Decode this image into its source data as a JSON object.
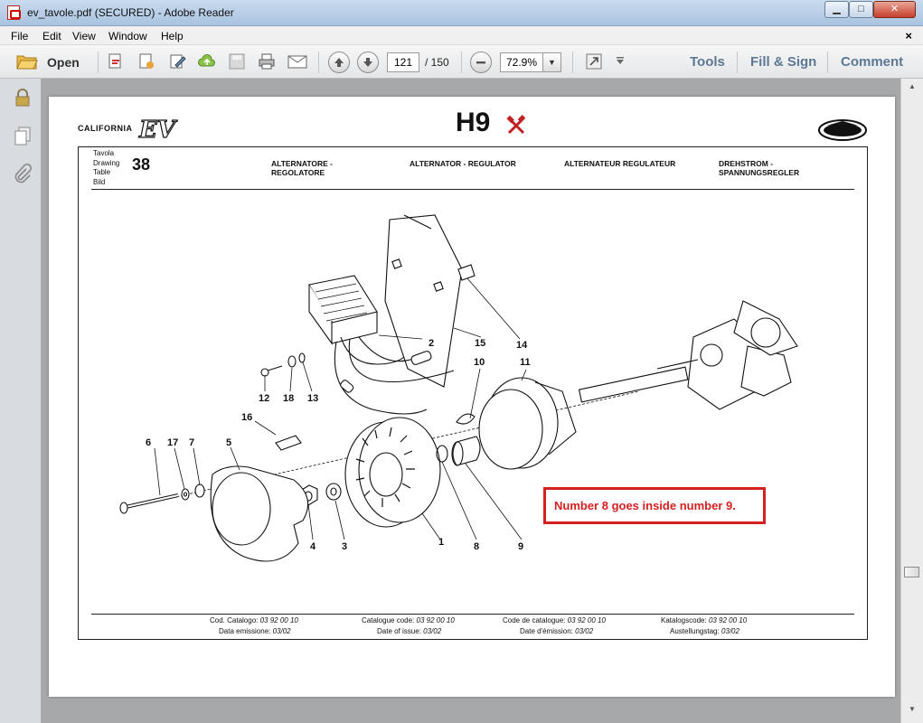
{
  "window": {
    "title": "ev_tavole.pdf (SECURED) - Adobe Reader",
    "min_glyph": "▁",
    "max_glyph": "□",
    "close_glyph": "✕"
  },
  "menu": {
    "items": [
      "File",
      "Edit",
      "View",
      "Window",
      "Help"
    ],
    "doc_close": "×"
  },
  "toolbar": {
    "open_label": "Open",
    "current_page": "121",
    "total_pages": "/ 150",
    "zoom": "72.9%",
    "tools_label": "Tools",
    "fill_sign_label": "Fill & Sign",
    "comment_label": "Comment"
  },
  "document": {
    "page_code": "H9",
    "brand_text": "CALIFORNIA",
    "brand_ev": "EV",
    "guzzi_text": "MOTO GUZZI",
    "table_words": [
      "Tavola",
      "Drawing",
      "Table",
      "Bild"
    ],
    "table_number": "38",
    "titles": {
      "it": "ALTERNATORE -\nREGOLATORE",
      "en": "ALTERNATOR - REGULATOR",
      "fr": "ALTERNATEUR REGULATEUR",
      "de": "DREHSTROM -\nSPANNUNGSREGLER"
    },
    "footer": [
      {
        "label": "Cod. Catalogo:",
        "value": "03 92 00 10",
        "issue_label": "Data emissione:",
        "issue_value": "03/02"
      },
      {
        "label": "Catalogue code:",
        "value": "03 92 00 10",
        "issue_label": "Date of issue:",
        "issue_value": "03/02"
      },
      {
        "label": "Code de catalogue:",
        "value": "03 92 00 10",
        "issue_label": "Date d'émission:",
        "issue_value": "03/02"
      },
      {
        "label": "Katalogscode:",
        "value": "03 92 00 10",
        "issue_label": "Austellungstag:",
        "issue_value": "03/02"
      }
    ],
    "part_numbers": [
      "1",
      "2",
      "3",
      "4",
      "5",
      "6",
      "7",
      "8",
      "9",
      "10",
      "11",
      "12",
      "13",
      "14",
      "15",
      "16",
      "17",
      "18"
    ],
    "annotation": "Number 8 goes inside number 9."
  },
  "colors": {
    "annotation": "#d42020",
    "tools_link": "#5c7893"
  },
  "icons": [
    "pdf-app-icon",
    "open-folder-icon",
    "create-pdf-icon",
    "export-pdf-icon",
    "edit-icon",
    "cloud-upload-icon",
    "save-icon",
    "print-icon",
    "email-icon",
    "prev-page-icon",
    "next-page-icon",
    "zoom-out-icon",
    "fullscreen-icon",
    "lock-icon",
    "pages-icon",
    "attachment-icon",
    "tools-crossed-icon"
  ]
}
